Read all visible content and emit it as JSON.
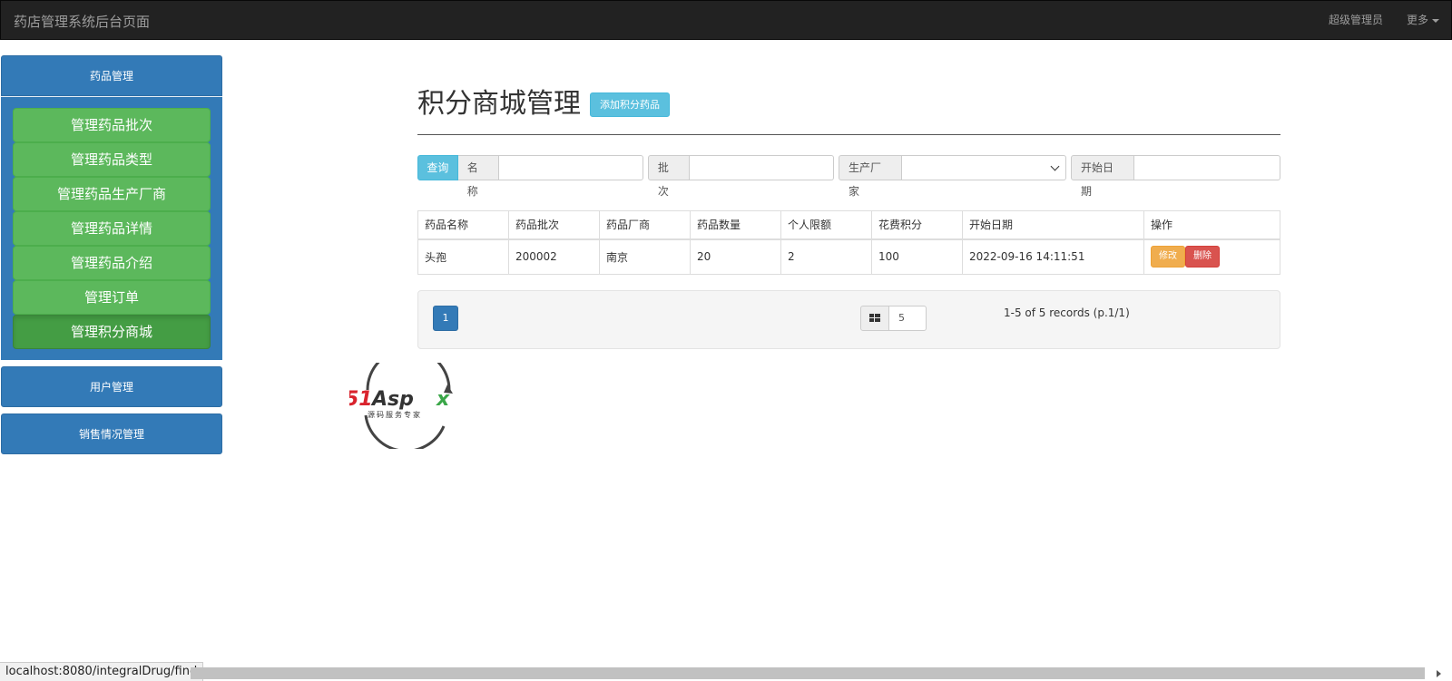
{
  "navbar": {
    "brand": "药店管理系统后台页面",
    "admin_label": "超级管理员",
    "more_label": "更多"
  },
  "sidebar": {
    "drug_section": "药品管理",
    "items": [
      {
        "label": "管理药品批次"
      },
      {
        "label": "管理药品类型"
      },
      {
        "label": "管理药品生产厂商"
      },
      {
        "label": "管理药品详情"
      },
      {
        "label": "管理药品介绍"
      },
      {
        "label": "管理订单"
      },
      {
        "label": "管理积分商城",
        "active": true
      }
    ],
    "user_section": "用户管理",
    "sales_section": "销售情况管理"
  },
  "main": {
    "title": "积分商城管理",
    "add_button": "添加积分药品",
    "search": {
      "query_button": "查询",
      "name_label": "名称",
      "name_value": "",
      "batch_label": "批次",
      "batch_value": "",
      "manufacturer_label": "生产厂家",
      "manufacturer_value": "",
      "start_date_label": "开始日期",
      "start_date_value": ""
    },
    "table": {
      "headers": [
        "药品名称",
        "药品批次",
        "药品厂商",
        "药品数量",
        "个人限额",
        "花费积分",
        "开始日期",
        "操作"
      ],
      "rows": [
        {
          "name": "头孢",
          "batch": "200002",
          "manufacturer": "南京",
          "quantity": "20",
          "limit": "2",
          "points": "100",
          "start_date": "2022-09-16 14:11:51",
          "edit_label": "修改",
          "delete_label": "删除"
        }
      ]
    },
    "pager": {
      "current_page": "1",
      "page_size": "5",
      "records_text": "1-5 of 5 records (p.1/1)"
    }
  },
  "watermark": {
    "brand": "51Aspx",
    "tagline": "源码服务专家"
  },
  "statusbar": {
    "url": "localhost:8080/integralDrug/find"
  },
  "colors": {
    "navbar_bg": "#222222",
    "primary": "#337ab7",
    "success": "#5cb85c",
    "info": "#5bc0de",
    "warning": "#f0ad4e",
    "danger": "#d9534f"
  }
}
